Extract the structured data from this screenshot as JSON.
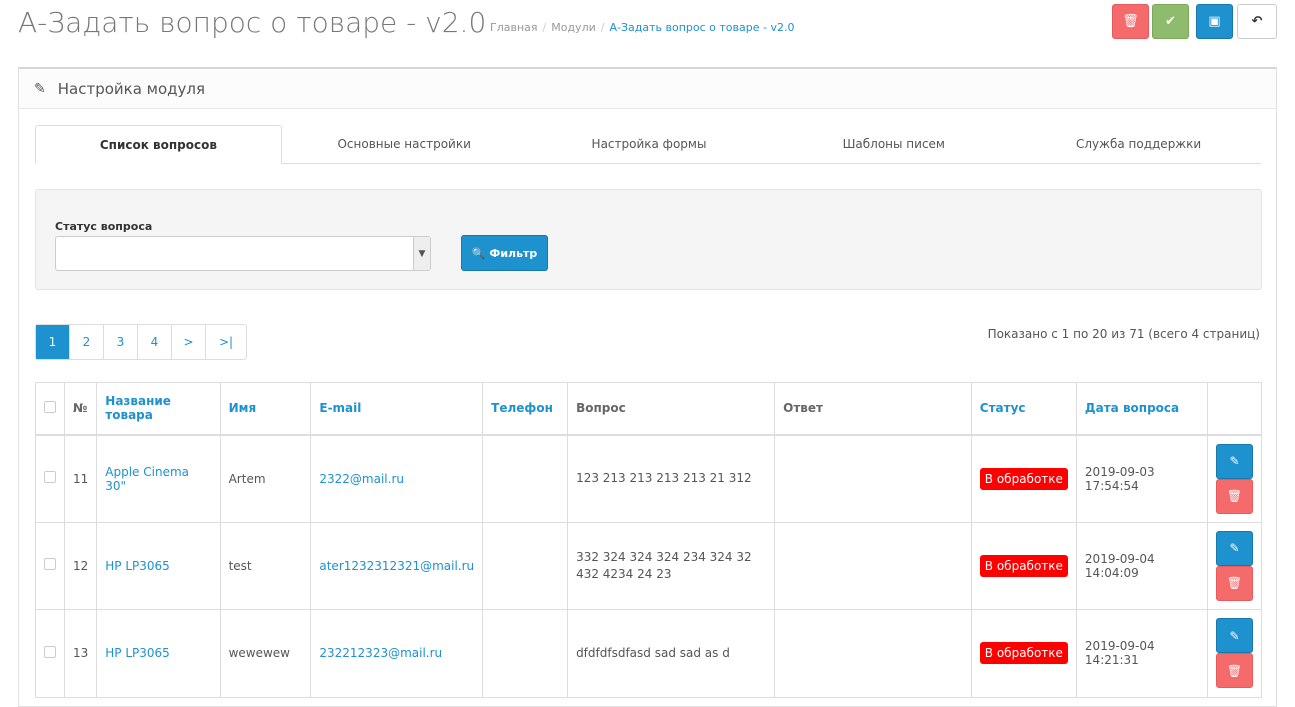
{
  "header": {
    "title": "А-Задать вопрос о товаре - v2.0",
    "breadcrumb": [
      "Главная",
      "Модули",
      "А-Задать вопрос о товаре - v2.0"
    ]
  },
  "toolbar": {
    "delete_icon": "🗑",
    "confirm_icon": "✔",
    "save_icon": "💾",
    "back_icon": "↶"
  },
  "panel": {
    "title": "Настройка модуля",
    "tabs": [
      "Список вопросов",
      "Основные настройки",
      "Настройка формы",
      "Шаблоны писем",
      "Служба поддержки"
    ]
  },
  "filter": {
    "status_label": "Статус вопроса",
    "status_value": "",
    "button": "Фильтр"
  },
  "pagination": {
    "pages": [
      "1",
      "2",
      "3",
      "4",
      ">",
      ">|"
    ],
    "info": "Показано с 1 по 20 из 71 (всего 4 страниц)"
  },
  "table": {
    "headers": [
      "№",
      "Название товара",
      "Имя",
      "E-mail",
      "Телефон",
      "Вопрос",
      "Ответ",
      "Статус",
      "Дата вопроса"
    ],
    "rows": [
      {
        "id": "11",
        "product": "Apple Cinema 30\"",
        "name": "Artem",
        "email": "2322@mail.ru",
        "phone": "",
        "question": "123 213 213 213 213 21 312",
        "answer": "",
        "status": "В обработке",
        "date": "2019-09-03 17:54:54"
      },
      {
        "id": "12",
        "product": "HP LP3065",
        "name": "test",
        "email": "ater1232312321@mail.ru",
        "phone": "",
        "question": "332 324 324 324 234 324 32 432 4234 24 23",
        "answer": "",
        "status": "В обработке",
        "date": "2019-09-04 14:04:09"
      },
      {
        "id": "13",
        "product": "HP LP3065",
        "name": "wewewew",
        "email": "232212323@mail.ru",
        "phone": "",
        "question": "dfdfdfsdfasd sad sad as d",
        "answer": "",
        "status": "В обработке",
        "date": "2019-09-04 14:21:31"
      }
    ]
  },
  "colors": {
    "primary": "#1e91cf",
    "danger": "#f56b6b",
    "success": "#8fbb6c",
    "status": "#ff0000"
  }
}
